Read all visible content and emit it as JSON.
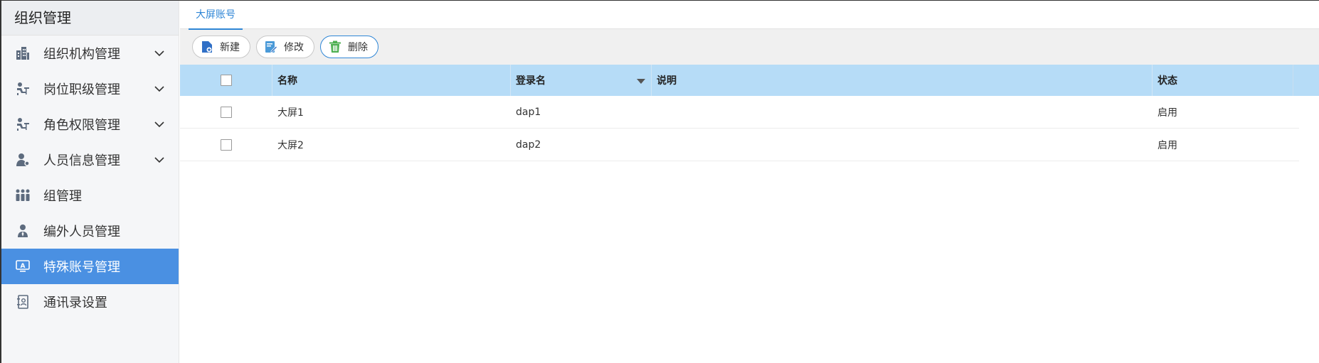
{
  "sidebar": {
    "title": "组织管理",
    "items": [
      {
        "label": "组织机构管理",
        "icon": "building-icon",
        "expandable": true
      },
      {
        "label": "岗位职级管理",
        "icon": "seat-person-icon",
        "expandable": true
      },
      {
        "label": "角色权限管理",
        "icon": "seat-person-icon",
        "expandable": true
      },
      {
        "label": "人员信息管理",
        "icon": "user-gear-icon",
        "expandable": true
      },
      {
        "label": "组管理",
        "icon": "group-icon",
        "expandable": false
      },
      {
        "label": "编外人员管理",
        "icon": "suit-person-icon",
        "expandable": false
      },
      {
        "label": "特殊账号管理",
        "icon": "id-card-icon",
        "expandable": false,
        "active": true
      },
      {
        "label": "通讯录设置",
        "icon": "contact-book-icon",
        "expandable": false
      }
    ]
  },
  "tabs": [
    {
      "label": "大屏账号",
      "active": true
    }
  ],
  "toolbar": {
    "new_label": "新建",
    "edit_label": "修改",
    "delete_label": "删除"
  },
  "table": {
    "columns": {
      "name": "名称",
      "login": "登录名",
      "desc": "说明",
      "status": "状态"
    },
    "rows": [
      {
        "name": "大屏1",
        "login": "dap1",
        "desc": "",
        "status": "启用"
      },
      {
        "name": "大屏2",
        "login": "dap2",
        "desc": "",
        "status": "启用"
      }
    ]
  },
  "colors": {
    "accent": "#4a90e2",
    "tab_active": "#2f86d6",
    "header_bg": "#b6dcf7",
    "icon_gray": "#5d6b7e"
  }
}
